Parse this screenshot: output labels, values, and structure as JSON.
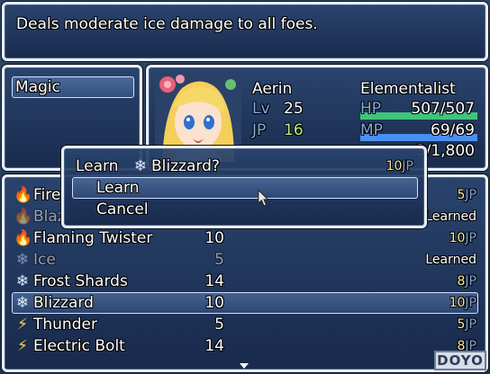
{
  "help": {
    "text": "Deals moderate ice damage to all foes."
  },
  "category": {
    "selected": "Magic"
  },
  "actor": {
    "name": "Aerin",
    "class": "Elementalist",
    "lv_label": "Lv",
    "lv": "25",
    "jp_label": "JP",
    "jp": "16",
    "hp_label": "HP",
    "hp": "507/507",
    "hp_ratio": 1.0,
    "mp_label": "MP",
    "mp": "69/69",
    "mp_ratio": 1.0,
    "exp_partial": "3/1,800"
  },
  "confirm": {
    "prompt_prefix": "Learn ",
    "skill": "Blizzard?",
    "cost_value": "10",
    "cost_unit": "JP",
    "options": [
      "Learn",
      "Cancel"
    ],
    "selected_index": 0
  },
  "skills": [
    {
      "name": "Fire",
      "cost": "",
      "status": "5",
      "unit": "JP",
      "icon": "fire-icon",
      "dim": false
    },
    {
      "name": "Blaze",
      "cost": "",
      "status": "Learned",
      "unit": "",
      "icon": "fire-icon",
      "dim": true
    },
    {
      "name": "Flaming Twister",
      "cost": "10",
      "status": "10",
      "unit": "JP",
      "icon": "fire-icon",
      "dim": false
    },
    {
      "name": "Ice",
      "cost": "5",
      "status": "Learned",
      "unit": "",
      "icon": "ice-icon",
      "dim": true
    },
    {
      "name": "Frost Shards",
      "cost": "14",
      "status": "8",
      "unit": "JP",
      "icon": "ice-icon",
      "dim": false
    },
    {
      "name": "Blizzard",
      "cost": "10",
      "status": "10",
      "unit": "JP",
      "icon": "ice-icon",
      "dim": false
    },
    {
      "name": "Thunder",
      "cost": "5",
      "status": "5",
      "unit": "JP",
      "icon": "bolt-icon",
      "dim": false
    },
    {
      "name": "Electric Bolt",
      "cost": "14",
      "status": "8",
      "unit": "JP",
      "icon": "bolt-icon",
      "dim": false
    }
  ],
  "list_selected_index": 5,
  "watermark": "DOYO",
  "colors": {
    "hp_gauge": "#3fc47a",
    "mp_gauge": "#4a90f0",
    "system": "#84a9dc"
  }
}
